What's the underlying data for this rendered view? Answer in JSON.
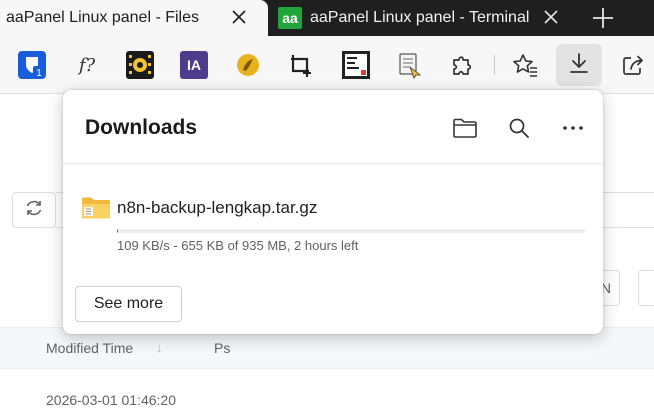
{
  "tabs": [
    {
      "title": "aaPanel Linux panel - Files",
      "active": true
    },
    {
      "title": "aaPanel Linux panel - Terminal",
      "active": false,
      "favicon_text": "aa"
    }
  ],
  "toolbar": {
    "extensions": [
      "bitwarden-icon",
      "fx-icon",
      "film-icon",
      "ia-icon",
      "gold-icon",
      "crop-icon",
      "design-icon",
      "note-icon",
      "puzzle-icon",
      "favorites-icon",
      "download-icon",
      "share-icon"
    ],
    "bitwarden_badge": "1",
    "fx_label": "f?",
    "ia_label": "IA",
    "design_label": "html to design"
  },
  "downloads": {
    "title": "Downloads",
    "item": {
      "name": "n8n-backup-lengkap.tar.gz",
      "status": "109 KB/s - 655 KB of 935 MB, 2 hours left",
      "progress_fraction": 0.0007
    },
    "see_more_label": "See more"
  },
  "page": {
    "n_button_label": "N",
    "columns": {
      "modified": "Modified Time",
      "ps": "Ps"
    },
    "first_row_time": "2026-03-01 01:46:20"
  },
  "colors": {
    "accent": "#0f6cbd",
    "tabstrip": "#1f1f1f",
    "aapanel_green": "#20a53a"
  }
}
